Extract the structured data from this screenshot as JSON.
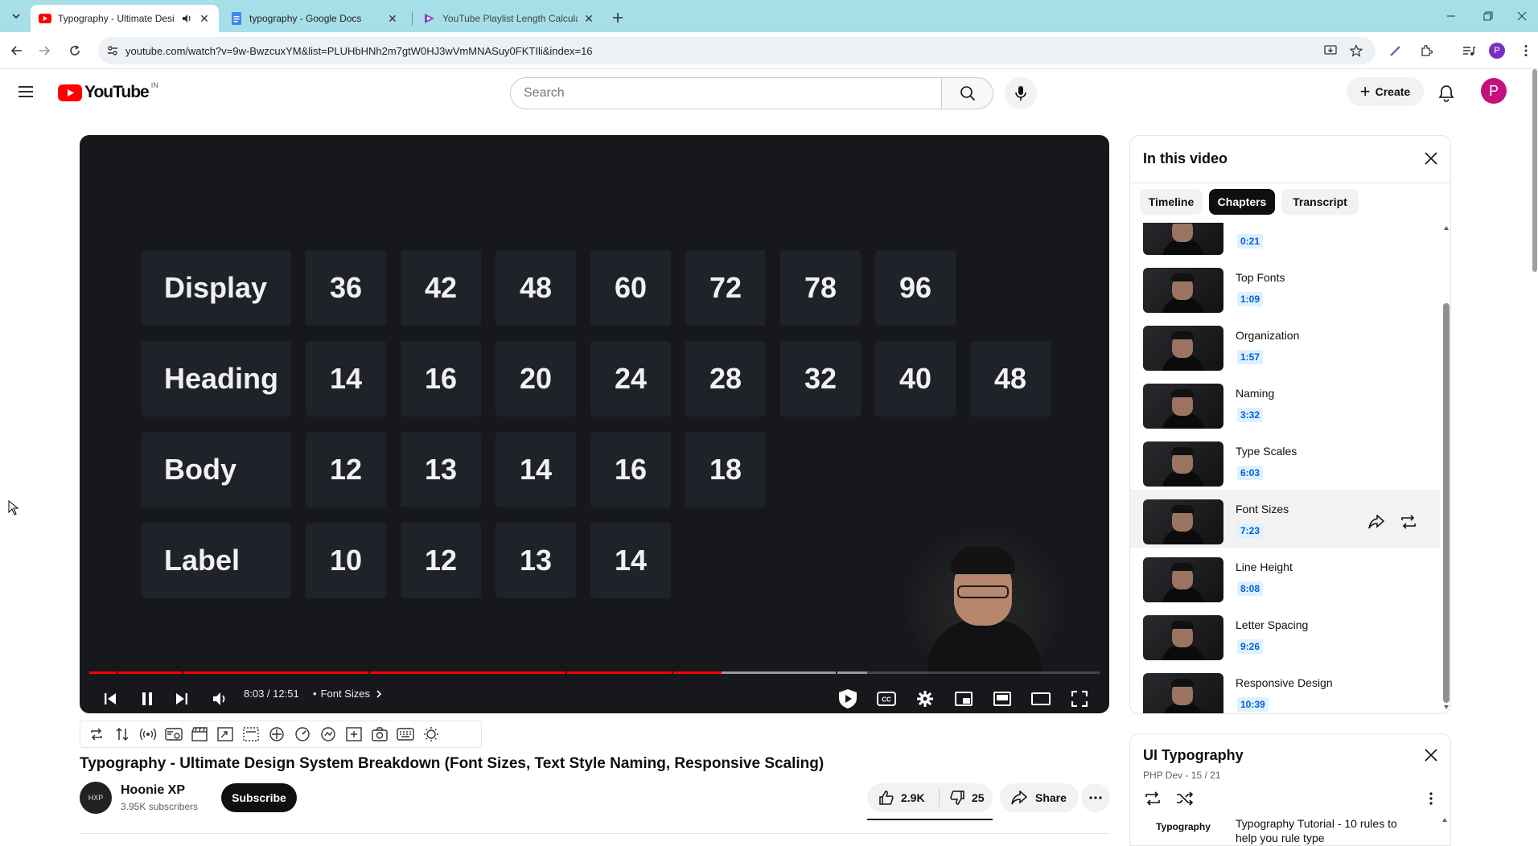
{
  "browser": {
    "tabs": [
      {
        "title": "Typography - Ultimate Desi",
        "active": true,
        "audio": true
      },
      {
        "title": "typography - Google Docs",
        "active": false
      },
      {
        "title": "YouTube Playlist Length Calcula",
        "active": false
      }
    ],
    "url": "youtube.com/watch?v=9w-BwzcuxYM&list=PLUHbHNh2m7gtW0HJ3wVmMNASuy0FKTIli&index=16",
    "profile_initial": "P"
  },
  "masthead": {
    "logo_word": "YouTube",
    "country_code": "IN",
    "search_placeholder": "Search",
    "create_label": "Create",
    "avatar_initial": "P"
  },
  "player": {
    "grid": [
      {
        "label": "Display",
        "values": [
          "36",
          "42",
          "48",
          "60",
          "72",
          "78",
          "96"
        ]
      },
      {
        "label": "Heading",
        "values": [
          "14",
          "16",
          "20",
          "24",
          "28",
          "32",
          "40",
          "48"
        ]
      },
      {
        "label": "Body",
        "values": [
          "12",
          "13",
          "14",
          "16",
          "18"
        ]
      },
      {
        "label": "Label",
        "values": [
          "10",
          "12",
          "13",
          "14"
        ]
      }
    ],
    "time": "8:03 / 12:51",
    "current_chapter": "Font Sizes",
    "progress_fraction": 0.626,
    "buffered_fraction": 0.77
  },
  "video": {
    "title": "Typography - Ultimate Design System Breakdown (Font Sizes, Text Style Naming, Responsive Scaling)",
    "channel": "Hoonie XP",
    "channel_avatar": "HXP",
    "subscribers": "3.95K subscribers",
    "subscribe_label": "Subscribe",
    "likes": "2.9K",
    "dislikes": "25",
    "share_label": "Share"
  },
  "panel": {
    "title": "In this video",
    "tabs": [
      "Timeline",
      "Chapters",
      "Transcript"
    ],
    "active_tab": "Chapters",
    "chapters": [
      {
        "name": "",
        "time": "0:21"
      },
      {
        "name": "Top Fonts",
        "time": "1:09"
      },
      {
        "name": "Organization",
        "time": "1:57"
      },
      {
        "name": "Naming",
        "time": "3:32"
      },
      {
        "name": "Type Scales",
        "time": "6:03"
      },
      {
        "name": "Font Sizes",
        "time": "7:23",
        "current": true
      },
      {
        "name": "Line Height",
        "time": "8:08"
      },
      {
        "name": "Letter Spacing",
        "time": "9:26"
      },
      {
        "name": "Responsive Design",
        "time": "10:39"
      }
    ]
  },
  "playlist": {
    "title": "UI Typography",
    "subtitle": "PHP Dev - 15 / 21",
    "item_thumb_text": "Typography",
    "item_title": "Typography Tutorial - 10 rules to help you rule type"
  },
  "colors": {
    "yt_red": "#ff0000",
    "tabbar": "#a6dfe7",
    "link_blue": "#065fd4"
  }
}
